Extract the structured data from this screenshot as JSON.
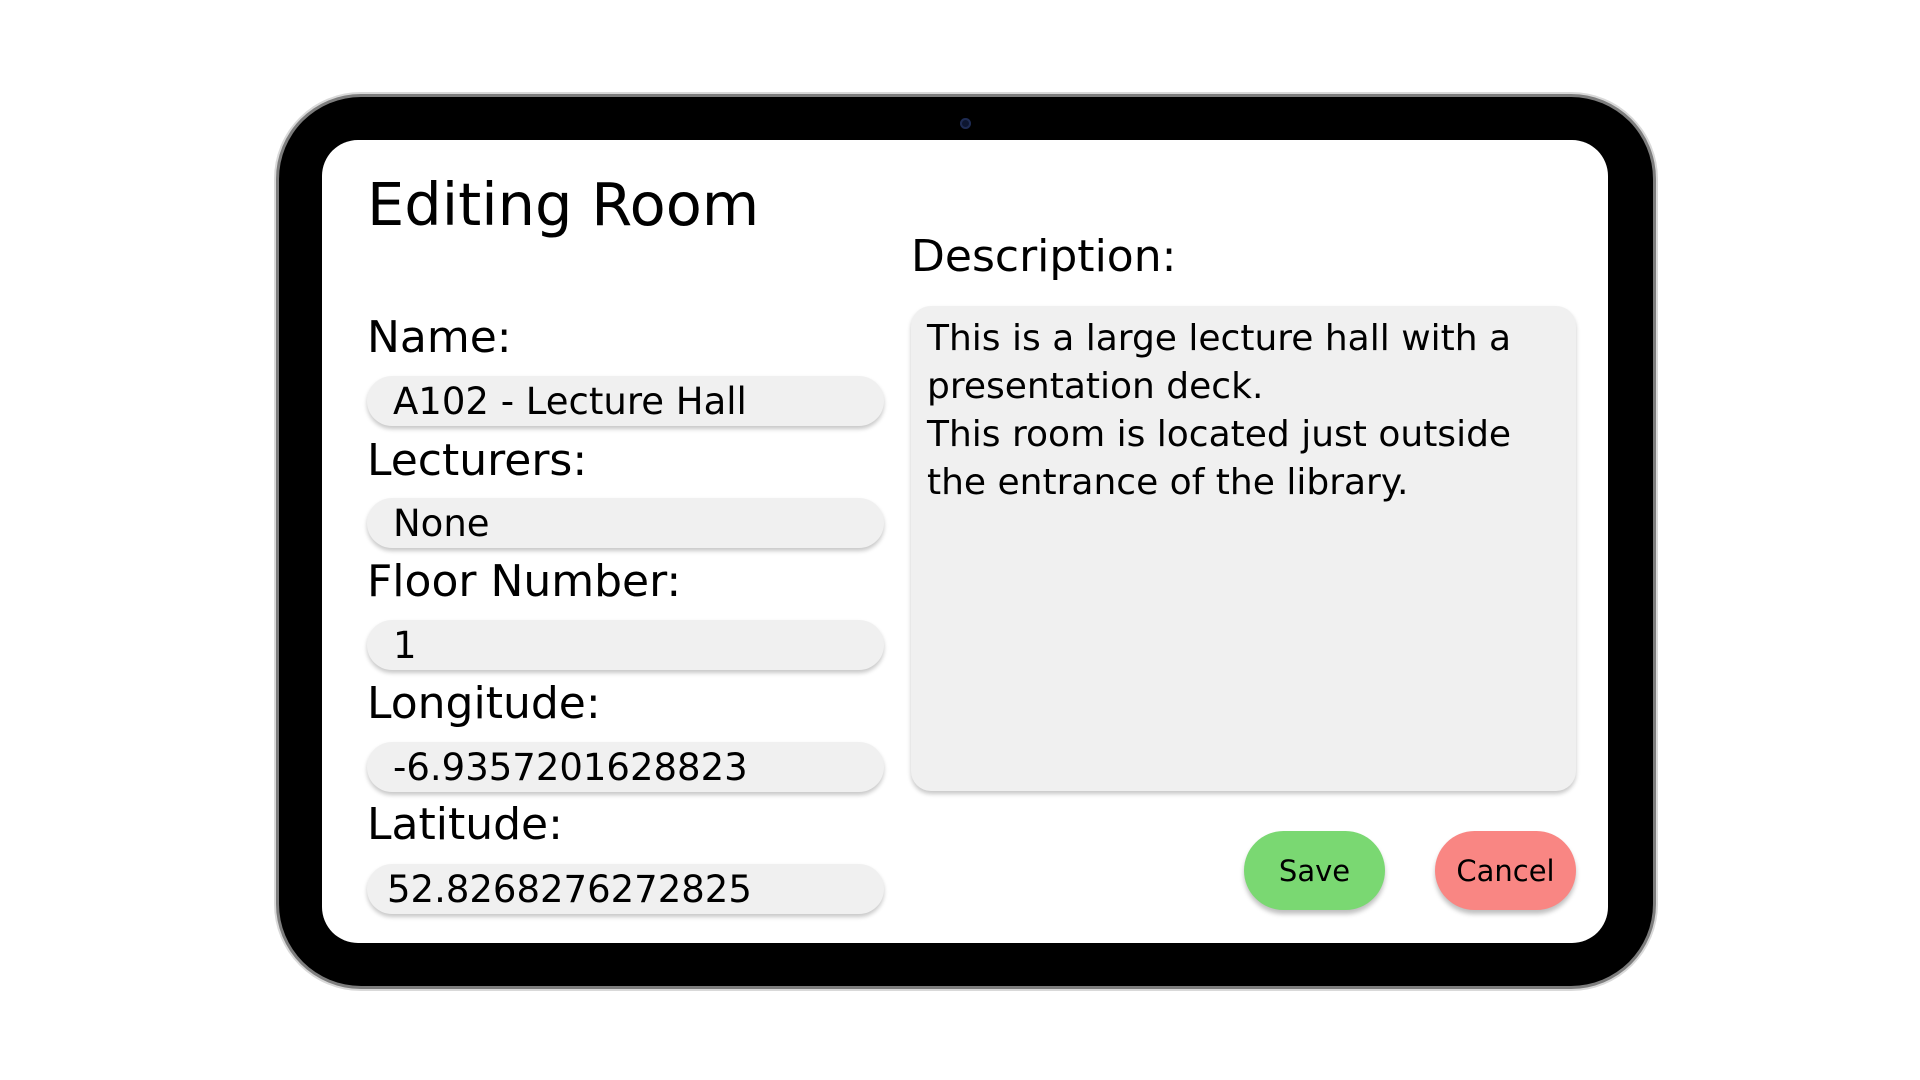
{
  "form": {
    "title": "Editing Room",
    "fields": [
      {
        "label": "Name:",
        "value": "A102 - Lecture Hall"
      },
      {
        "label": "Lecturers:",
        "value": "None"
      },
      {
        "label": "Floor Number:",
        "value": "1"
      },
      {
        "label": "Longitude:",
        "value": "-6.9357201628823"
      },
      {
        "label": "Latitude:",
        "value": "52.8268276272825"
      }
    ],
    "description": {
      "label": "Description:",
      "value": "This is a large lecture hall with a presentation deck.\nThis room is located just outside the entrance of the library."
    },
    "buttons": {
      "save": "Save",
      "cancel": "Cancel"
    }
  },
  "colors": {
    "save_button": "#7ad872",
    "cancel_button": "#f98683",
    "field_background": "#f0f0f0",
    "device_bezel": "#000000"
  },
  "icons": {
    "camera": "front-camera-icon"
  }
}
